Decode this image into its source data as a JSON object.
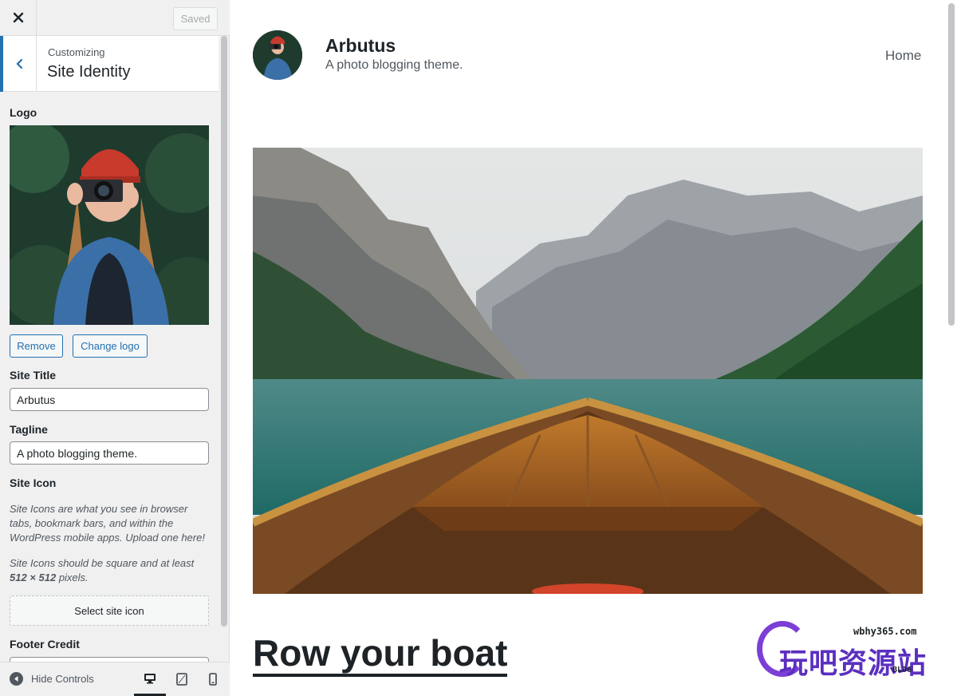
{
  "topbar": {
    "close_icon": "close-icon",
    "save_label": "Saved"
  },
  "section": {
    "customizing": "Customizing",
    "title": "Site Identity"
  },
  "controls": {
    "logo_label": "Logo",
    "remove_label": "Remove",
    "change_logo_label": "Change logo",
    "site_title_label": "Site Title",
    "site_title_value": "Arbutus",
    "tagline_label": "Tagline",
    "tagline_value": "A photo blogging theme.",
    "site_icon_label": "Site Icon",
    "site_icon_desc1": "Site Icons are what you see in browser tabs, bookmark bars, and within the WordPress mobile apps. Upload one here!",
    "site_icon_desc2_pre": "Site Icons should be square and at least ",
    "site_icon_desc2_bold": "512 × 512",
    "site_icon_desc2_post": " pixels.",
    "select_site_icon_label": "Select site icon",
    "footer_credit_label": "Footer Credit"
  },
  "footer": {
    "hide_controls_label": "Hide Controls",
    "devices": [
      "desktop-icon",
      "tablet-icon",
      "mobile-icon"
    ]
  },
  "preview": {
    "site_title": "Arbutus",
    "tagline": "A photo blogging theme.",
    "nav": [
      {
        "label": "Home"
      }
    ],
    "post_title": "Row your boat"
  },
  "watermark": {
    "url": "wbhy365.com",
    "text": "玩吧资源站",
    "badge": "BLOG"
  },
  "colors": {
    "accent": "#2271b1",
    "text": "#1d2327",
    "muted": "#50575e",
    "panel": "#f0f0f1",
    "watermark": "#5b2fc0"
  }
}
